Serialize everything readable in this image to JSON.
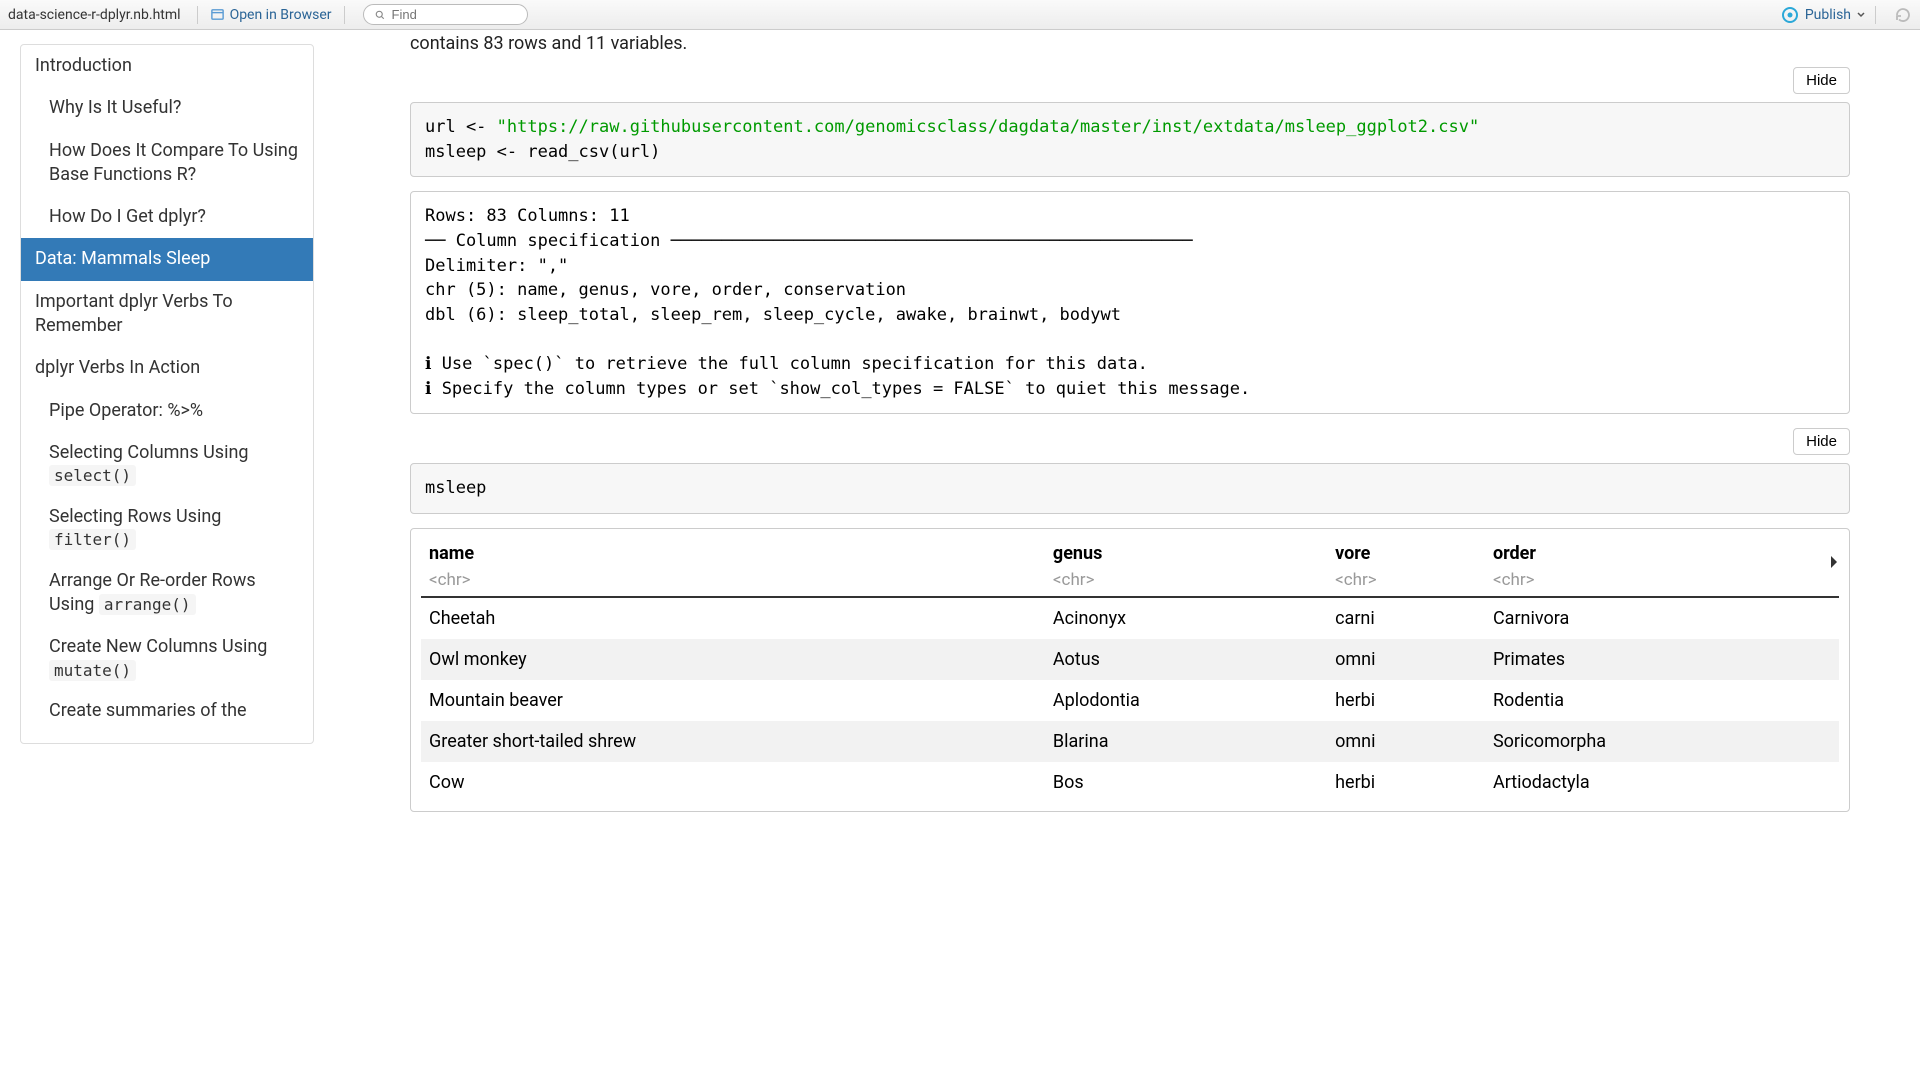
{
  "toolbar": {
    "filename": "data-science-r-dplyr.nb.html",
    "open_browser": "Open in Browser",
    "find_placeholder": "Find",
    "publish": "Publish"
  },
  "toc": [
    {
      "label": "Introduction",
      "level": 1,
      "active": false
    },
    {
      "label": "Why Is It Useful?",
      "level": 2,
      "active": false
    },
    {
      "label": "How Does It Compare To Using Base Functions R?",
      "level": 2,
      "active": false
    },
    {
      "label": "How Do I Get dplyr?",
      "level": 2,
      "active": false
    },
    {
      "label": "Data: Mammals Sleep",
      "level": 1,
      "active": true
    },
    {
      "label": "Important dplyr Verbs To Remember",
      "level": 1,
      "active": false
    },
    {
      "label": "dplyr Verbs In Action",
      "level": 1,
      "active": false
    },
    {
      "label": "Pipe Operator: %>%",
      "level": 2,
      "active": false
    },
    {
      "label_pre": "Selecting Columns Using ",
      "code": "select()",
      "level": 2,
      "active": false
    },
    {
      "label_pre": "Selecting Rows Using ",
      "code": "filter()",
      "level": 2,
      "active": false
    },
    {
      "label_pre": "Arrange Or Re-order Rows Using ",
      "code": "arrange()",
      "level": 2,
      "active": false
    },
    {
      "label_pre": "Create New Columns Using ",
      "code": "mutate()",
      "level": 2,
      "active": false
    },
    {
      "label": "Create summaries of the",
      "level": 2,
      "active": false
    }
  ],
  "intro_text": "contains 83 rows and 11 variables.",
  "hide_label": "Hide",
  "code1_pre": "url <- ",
  "code1_str": "\"https://raw.githubusercontent.com/genomicsclass/dagdata/master/inst/extdata/msleep_ggplot2.csv\"",
  "code1_post": "\nmsleep <- read_csv(url)",
  "output1": "Rows: 83 Columns: 11\n── Column specification ───────────────────────────────────────────────────\nDelimiter: \",\"\nchr (5): name, genus, vore, order, conservation\ndbl (6): sleep_total, sleep_rem, sleep_cycle, awake, brainwt, bodywt\n\nℹ Use `spec()` to retrieve the full column specification for this data.\nℹ Specify the column types or set `show_col_types = FALSE` to quiet this message.",
  "code2": "msleep",
  "table": {
    "columns": [
      {
        "name": "name",
        "type": "<chr>"
      },
      {
        "name": "genus",
        "type": "<chr>"
      },
      {
        "name": "vore",
        "type": "<chr>"
      },
      {
        "name": "order",
        "type": "<chr>"
      }
    ],
    "rows": [
      [
        "Cheetah",
        "Acinonyx",
        "carni",
        "Carnivora"
      ],
      [
        "Owl monkey",
        "Aotus",
        "omni",
        "Primates"
      ],
      [
        "Mountain beaver",
        "Aplodontia",
        "herbi",
        "Rodentia"
      ],
      [
        "Greater short-tailed shrew",
        "Blarina",
        "omni",
        "Soricomorpha"
      ],
      [
        "Cow",
        "Bos",
        "herbi",
        "Artiodactyla"
      ]
    ]
  }
}
